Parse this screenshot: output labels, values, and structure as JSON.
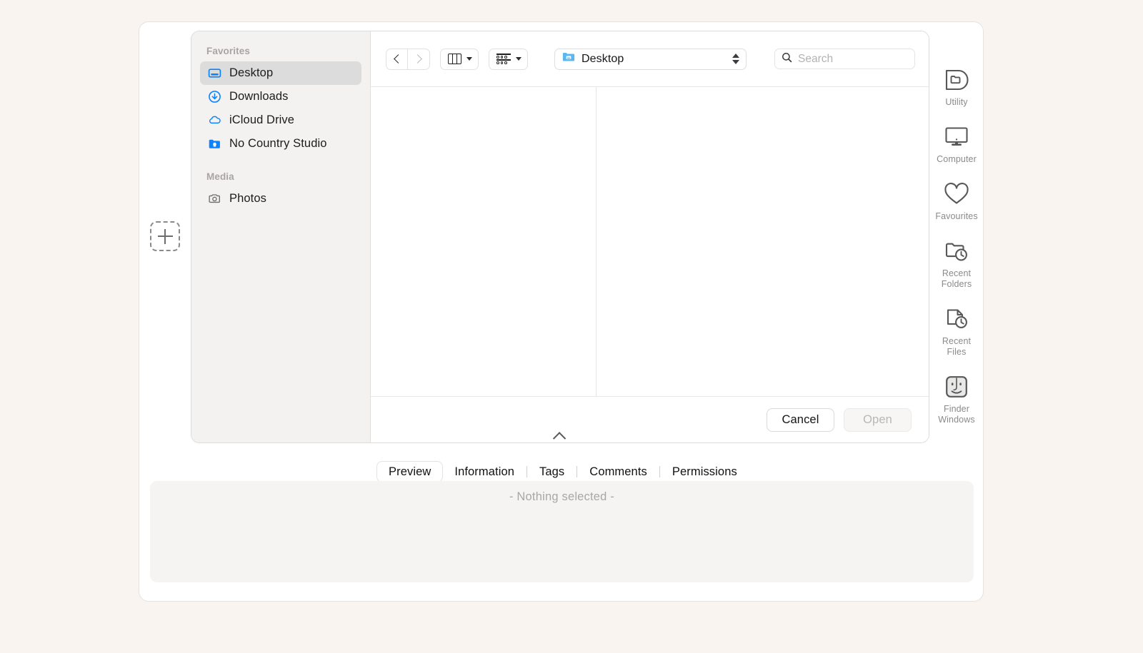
{
  "sidebar": {
    "sections": [
      {
        "header": "Favorites",
        "items": [
          {
            "label": "Desktop",
            "icon": "desktop-icon",
            "selected": true
          },
          {
            "label": "Downloads",
            "icon": "downloads-icon",
            "selected": false
          },
          {
            "label": "iCloud Drive",
            "icon": "icloud-icon",
            "selected": false
          },
          {
            "label": "No Country Studio",
            "icon": "shared-folder-icon",
            "selected": false
          }
        ]
      },
      {
        "header": "Media",
        "items": [
          {
            "label": "Photos",
            "icon": "photos-camera-icon",
            "selected": false
          }
        ]
      }
    ]
  },
  "toolbar": {
    "back_icon": "chevron-left-icon",
    "forward_icon": "chevron-right-icon",
    "view_mode_icon": "column-view-icon",
    "group_by_icon": "group-by-icon",
    "path_label": "Desktop",
    "path_icon": "blue-folder-icon"
  },
  "search": {
    "placeholder": "Search",
    "value": "",
    "icon": "search-icon"
  },
  "actions": {
    "cancel_label": "Cancel",
    "open_label": "Open",
    "open_disabled": true
  },
  "icon_rail": [
    {
      "label": "Utility",
      "icon": "utility-folder-icon"
    },
    {
      "label": "Computer",
      "icon": "computer-display-icon"
    },
    {
      "label": "Favourites",
      "icon": "heart-icon"
    },
    {
      "label": "Recent\nFolders",
      "icon": "recent-folders-icon"
    },
    {
      "label": "Recent\nFiles",
      "icon": "recent-files-icon"
    },
    {
      "label": "Finder\nWindows",
      "icon": "finder-face-icon"
    }
  ],
  "tabs": [
    {
      "label": "Preview",
      "active": true
    },
    {
      "label": "Information",
      "active": false
    },
    {
      "label": "Tags",
      "active": false
    },
    {
      "label": "Comments",
      "active": false
    },
    {
      "label": "Permissions",
      "active": false
    }
  ],
  "preview": {
    "empty_text": "- Nothing selected -"
  },
  "dropzone": {
    "icon": "add-plus-dashed-icon"
  },
  "colors": {
    "page_background": "#f9f4f0",
    "sidebar_background": "#f3f2f1",
    "selection": "#dcdcdc",
    "accent_blue": "#0a84ff",
    "muted_text": "#a9a7a5"
  }
}
